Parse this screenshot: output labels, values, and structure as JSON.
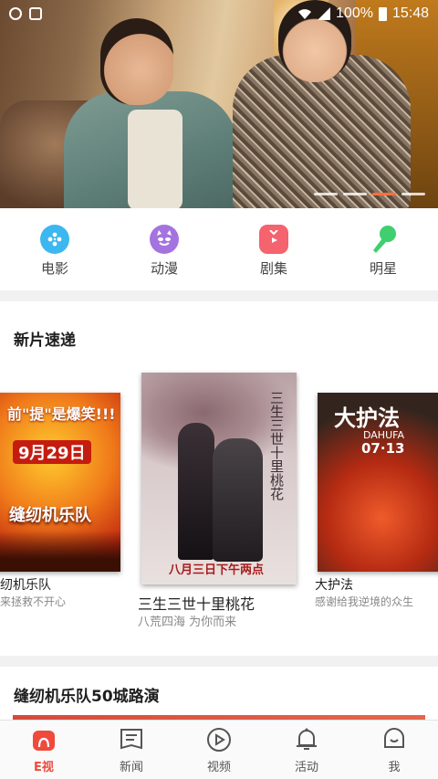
{
  "status_bar": {
    "battery": "100%",
    "time": "15:48"
  },
  "hero": {
    "slides": 4,
    "active_slide": 3
  },
  "categories": [
    {
      "label": "电影",
      "icon": "film-reel-icon",
      "color": "#3cb7f0"
    },
    {
      "label": "动漫",
      "icon": "anime-devil-icon",
      "color": "#a473e0"
    },
    {
      "label": "剧集",
      "icon": "tv-icon",
      "color": "#f4636e"
    },
    {
      "label": "明星",
      "icon": "microphone-icon",
      "color": "#3fcf6e"
    }
  ],
  "new_releases": {
    "title": "新片速递",
    "items": [
      {
        "title": "缝纫机乐队",
        "subtitle": "我来拯救不开心",
        "poster": {
          "line1": "前\"提\"是爆笑!!!",
          "line2": "9月29日",
          "line3": "缝纫机乐队",
          "caption_cut": "纫机乐队",
          "sub_cut": "来拯救不开心"
        }
      },
      {
        "title": "三生三世十里桃花",
        "subtitle": "八荒四海 为你而来",
        "poster": {
          "vertical": "三生三世十里桃花",
          "date": "八月三日下午两点"
        }
      },
      {
        "title": "大护法",
        "subtitle": "感谢给我逆境的众生",
        "poster": {
          "line1": "大护法",
          "line2": "DAHUFA",
          "line3": "07·13"
        }
      }
    ]
  },
  "second_section": {
    "title": "缝纫机乐队50城路演"
  },
  "tabbar": [
    {
      "label": "E视",
      "icon": "home-icon",
      "active": true
    },
    {
      "label": "新闻",
      "icon": "news-icon",
      "active": false
    },
    {
      "label": "视频",
      "icon": "video-play-icon",
      "active": false
    },
    {
      "label": "活动",
      "icon": "bell-icon",
      "active": false
    },
    {
      "label": "我",
      "icon": "profile-icon",
      "active": false
    }
  ],
  "colors": {
    "accent": "#ef4a3c",
    "divider": "#f1f1f1"
  }
}
